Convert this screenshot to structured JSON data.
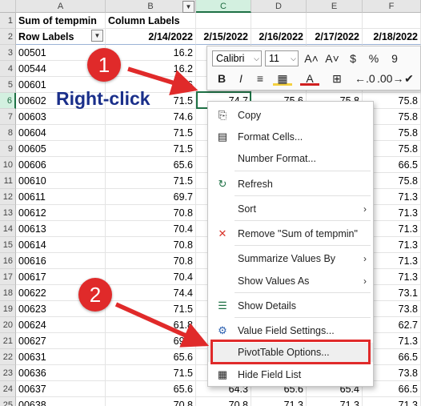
{
  "sheet": {
    "columns": [
      "A",
      "B",
      "C",
      "D",
      "E",
      "F"
    ],
    "selected_column": "C",
    "row_numbers": [
      "1",
      "2",
      "3",
      "4",
      "5",
      "6",
      "7",
      "8",
      "9",
      "10",
      "11",
      "12",
      "13",
      "14",
      "15",
      "16",
      "17",
      "18",
      "19",
      "20",
      "21",
      "22",
      "23",
      "24",
      "25"
    ],
    "selected_row": "6",
    "header_row1": {
      "a": "Sum of tempmin",
      "b": "Column Labels"
    },
    "header_row2": {
      "a": "Row Labels",
      "dates": [
        "2/14/2022",
        "2/15/2022",
        "2/16/2022",
        "2/17/2022",
        "2/18/2022"
      ]
    },
    "rows": [
      {
        "label": "00501",
        "b": "16.2",
        "f": "16.2"
      },
      {
        "label": "00544",
        "b": "16.2",
        "f": "16.2"
      },
      {
        "label": "00601",
        "b": "66.6",
        "f": "66.5"
      },
      {
        "label": "00602",
        "b": "71.5",
        "c": "74.7",
        "d": "75.6",
        "e": "75.8",
        "f": "75.8"
      },
      {
        "label": "00603",
        "b": "74.6",
        "f": "75.8"
      },
      {
        "label": "00604",
        "b": "71.5",
        "f": "75.8"
      },
      {
        "label": "00605",
        "b": "71.5",
        "f": "75.8"
      },
      {
        "label": "00606",
        "b": "65.6",
        "f": "66.5"
      },
      {
        "label": "00610",
        "b": "71.5",
        "f": "75.8"
      },
      {
        "label": "00611",
        "b": "69.7",
        "f": "71.3"
      },
      {
        "label": "00612",
        "b": "70.8",
        "f": "71.3"
      },
      {
        "label": "00613",
        "b": "70.4",
        "f": "71.3"
      },
      {
        "label": "00614",
        "b": "70.8",
        "f": "71.3"
      },
      {
        "label": "00616",
        "b": "70.8",
        "f": "71.3"
      },
      {
        "label": "00617",
        "b": "70.4",
        "f": "71.3"
      },
      {
        "label": "00622",
        "b": "74.4",
        "f": "73.1"
      },
      {
        "label": "00623",
        "b": "71.5",
        "f": "73.8"
      },
      {
        "label": "00624",
        "b": "61.8",
        "f": "62.7"
      },
      {
        "label": "00627",
        "b": "69.7",
        "f": "71.3"
      },
      {
        "label": "00631",
        "b": "65.6",
        "f": "66.5"
      },
      {
        "label": "00636",
        "b": "71.5",
        "f": "73.8"
      },
      {
        "label": "00637",
        "b": "65.6",
        "c": "64.3",
        "d": "65.6",
        "e": "65.4",
        "f": "66.5"
      },
      {
        "label": "00638",
        "b": "70.8",
        "c": "70.8",
        "d": "71.3",
        "e": "71.3",
        "f": "71.3"
      }
    ]
  },
  "mini_toolbar": {
    "font_name": "Calibri",
    "font_size": "11",
    "buttons_row1": [
      "A˄",
      "A˅",
      "$",
      "%",
      "9"
    ],
    "buttons_row2": [
      "B",
      "I",
      "≡",
      "▦",
      "A",
      "⊞",
      "←.0",
      ".00→",
      "✔"
    ]
  },
  "context_menu": {
    "items": [
      {
        "label": "Copy",
        "icon": "copy-icon",
        "glyph": "⎘"
      },
      {
        "label": "Format Cells...",
        "icon": "format-cells-icon",
        "glyph": "▤"
      },
      {
        "label": "Number Format...",
        "icon": "",
        "glyph": ""
      },
      {
        "label": "Refresh",
        "icon": "refresh-icon",
        "glyph": "↻"
      },
      {
        "label": "Sort",
        "icon": "",
        "glyph": "",
        "submenu": "›"
      },
      {
        "label": "Remove \"Sum of tempmin\"",
        "icon": "remove-x-icon",
        "glyph": "✕"
      },
      {
        "label": "Summarize Values By",
        "icon": "",
        "glyph": "",
        "submenu": "›"
      },
      {
        "label": "Show Values As",
        "icon": "",
        "glyph": "",
        "submenu": "›"
      },
      {
        "label": "Show Details",
        "icon": "show-details-icon",
        "glyph": "☰"
      },
      {
        "label": "Value Field Settings...",
        "icon": "value-field-settings-icon",
        "glyph": "⚙"
      },
      {
        "label": "PivotTable Options...",
        "icon": "",
        "glyph": ""
      },
      {
        "label": "Hide Field List",
        "icon": "field-list-icon",
        "glyph": "▦"
      }
    ]
  },
  "annotations": {
    "step1": "1",
    "step2": "2",
    "right_click": "Right-click",
    "accent": "#e02a2a",
    "text_color": "#1a2f8a"
  }
}
